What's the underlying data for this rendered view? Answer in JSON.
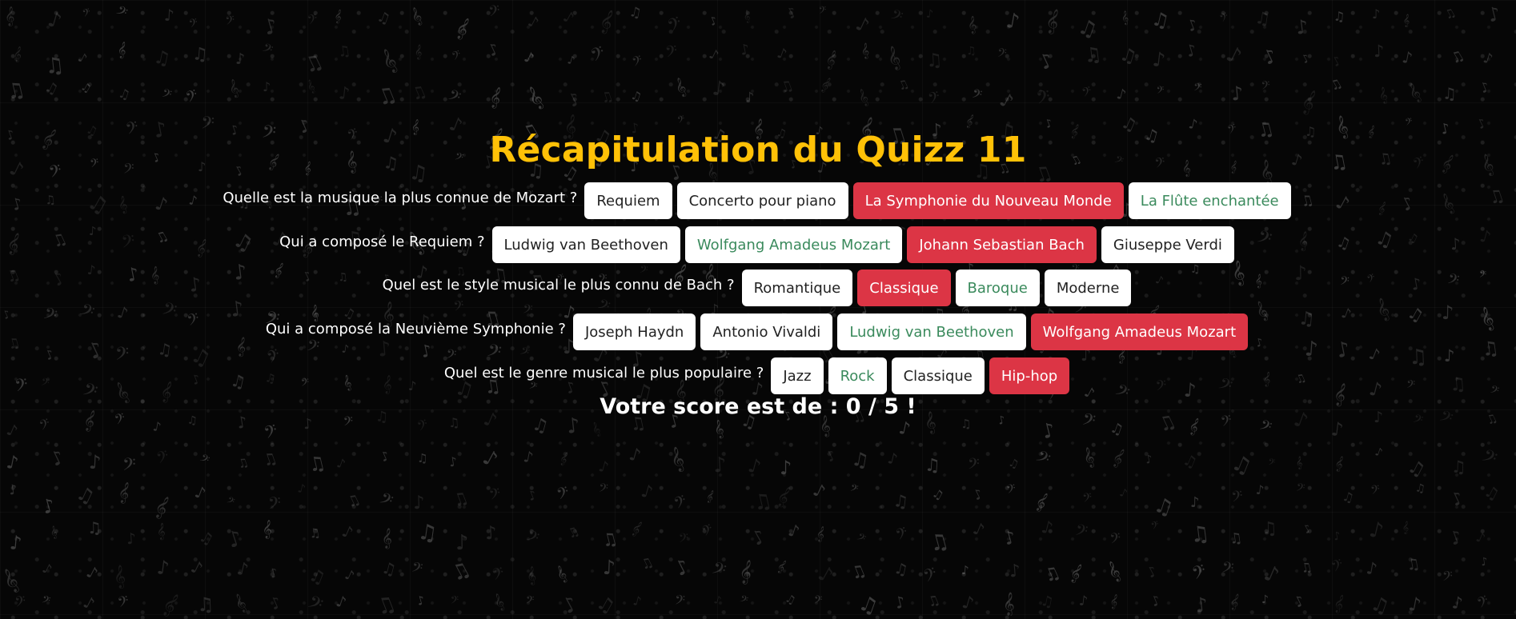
{
  "title": "Récapitulation du Quizz 11",
  "questions": [
    {
      "text": "Quelle est la musique la plus connue de Mozart ?",
      "answers": [
        {
          "label": "Requiem",
          "state": "neutral"
        },
        {
          "label": "Concerto pour piano",
          "state": "neutral"
        },
        {
          "label": "La Symphonie du Nouveau Monde",
          "state": "wrong"
        },
        {
          "label": "La Flûte enchantée",
          "state": "correct"
        }
      ]
    },
    {
      "text": "Qui a composé le Requiem ?",
      "answers": [
        {
          "label": "Ludwig van Beethoven",
          "state": "neutral"
        },
        {
          "label": "Wolfgang Amadeus Mozart",
          "state": "correct"
        },
        {
          "label": "Johann Sebastian Bach",
          "state": "wrong"
        },
        {
          "label": "Giuseppe Verdi",
          "state": "neutral"
        }
      ]
    },
    {
      "text": "Quel est le style musical le plus connu de Bach ?",
      "answers": [
        {
          "label": "Romantique",
          "state": "neutral"
        },
        {
          "label": "Classique",
          "state": "wrong"
        },
        {
          "label": "Baroque",
          "state": "correct"
        },
        {
          "label": "Moderne",
          "state": "neutral"
        }
      ]
    },
    {
      "text": "Qui a composé la Neuvième Symphonie ?",
      "answers": [
        {
          "label": "Joseph Haydn",
          "state": "neutral"
        },
        {
          "label": "Antonio Vivaldi",
          "state": "neutral"
        },
        {
          "label": "Ludwig van Beethoven",
          "state": "correct"
        },
        {
          "label": "Wolfgang Amadeus Mozart",
          "state": "wrong"
        }
      ]
    },
    {
      "text": "Quel est le genre musical le plus populaire ?",
      "answers": [
        {
          "label": "Jazz",
          "state": "neutral"
        },
        {
          "label": "Rock",
          "state": "correct"
        },
        {
          "label": "Classique",
          "state": "neutral"
        },
        {
          "label": "Hip-hop",
          "state": "wrong"
        }
      ]
    }
  ],
  "score": "Votre score est de : 0 / 5 !",
  "colors": {
    "title": "#ffc107",
    "wrong_bg": "#dc3545",
    "correct_text": "#3a8a5c",
    "background": "#060606"
  },
  "background_icons": [
    "music-note-icon",
    "treble-clef-icon",
    "bass-clef-icon",
    "beamed-notes-icon"
  ]
}
